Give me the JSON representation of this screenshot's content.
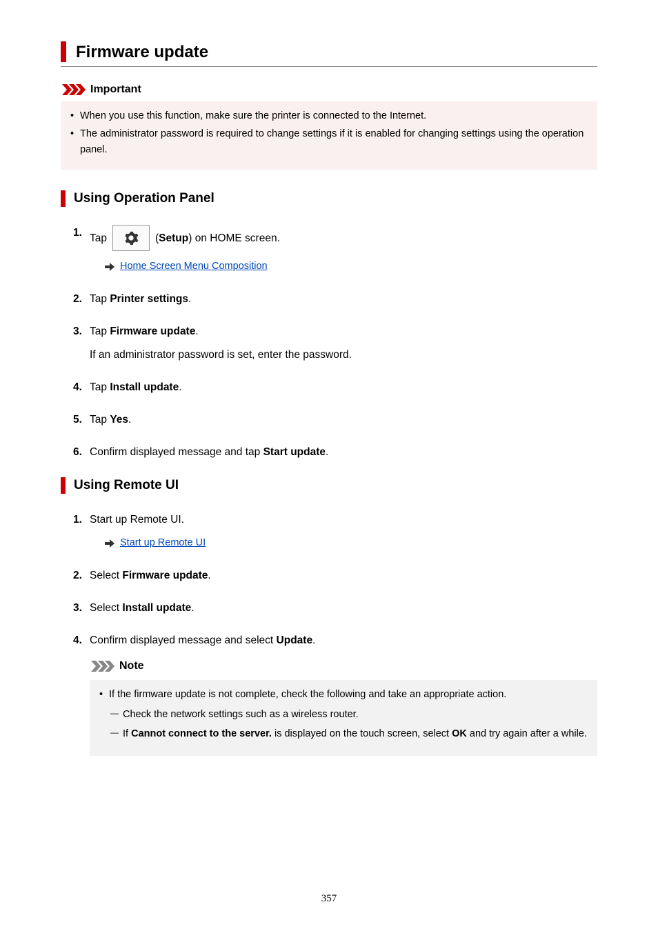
{
  "title": "Firmware update",
  "important": {
    "label": "Important",
    "items": [
      "When you use this function, make sure the printer is connected to the Internet.",
      "The administrator password is required to change settings if it is enabled for changing settings using the operation panel."
    ]
  },
  "section1": {
    "heading": "Using Operation Panel",
    "step1_pre": "Tap",
    "step1_mid": "(",
    "step1_bold": "Setup",
    "step1_post": ") on HOME screen.",
    "step1_link": "Home Screen Menu Composition",
    "step2_pre": "Tap ",
    "step2_bold": "Printer settings",
    "step2_post": ".",
    "step3_pre": "Tap ",
    "step3_bold": "Firmware update",
    "step3_post": ".",
    "step3_sub": "If an administrator password is set, enter the password.",
    "step4_pre": "Tap ",
    "step4_bold": "Install update",
    "step4_post": ".",
    "step5_pre": "Tap ",
    "step5_bold": "Yes",
    "step5_post": ".",
    "step6_pre": "Confirm displayed message and tap ",
    "step6_bold": "Start update",
    "step6_post": "."
  },
  "section2": {
    "heading": "Using Remote UI",
    "step1_text": "Start up Remote UI.",
    "step1_link": "Start up Remote UI",
    "step2_pre": "Select ",
    "step2_bold": "Firmware update",
    "step2_post": ".",
    "step3_pre": "Select ",
    "step3_bold": "Install update",
    "step3_post": ".",
    "step4_pre": "Confirm displayed message and select ",
    "step4_bold": "Update",
    "step4_post": "."
  },
  "note": {
    "label": "Note",
    "lead": "If the firmware update is not complete, check the following and take an appropriate action.",
    "sub1": "Check the network settings such as a wireless router.",
    "sub2_pre": "If ",
    "sub2_bold1": "Cannot connect to the server.",
    "sub2_mid": " is displayed on the touch screen, select ",
    "sub2_bold2": "OK",
    "sub2_post": " and try again after a while."
  },
  "page_number": "357"
}
